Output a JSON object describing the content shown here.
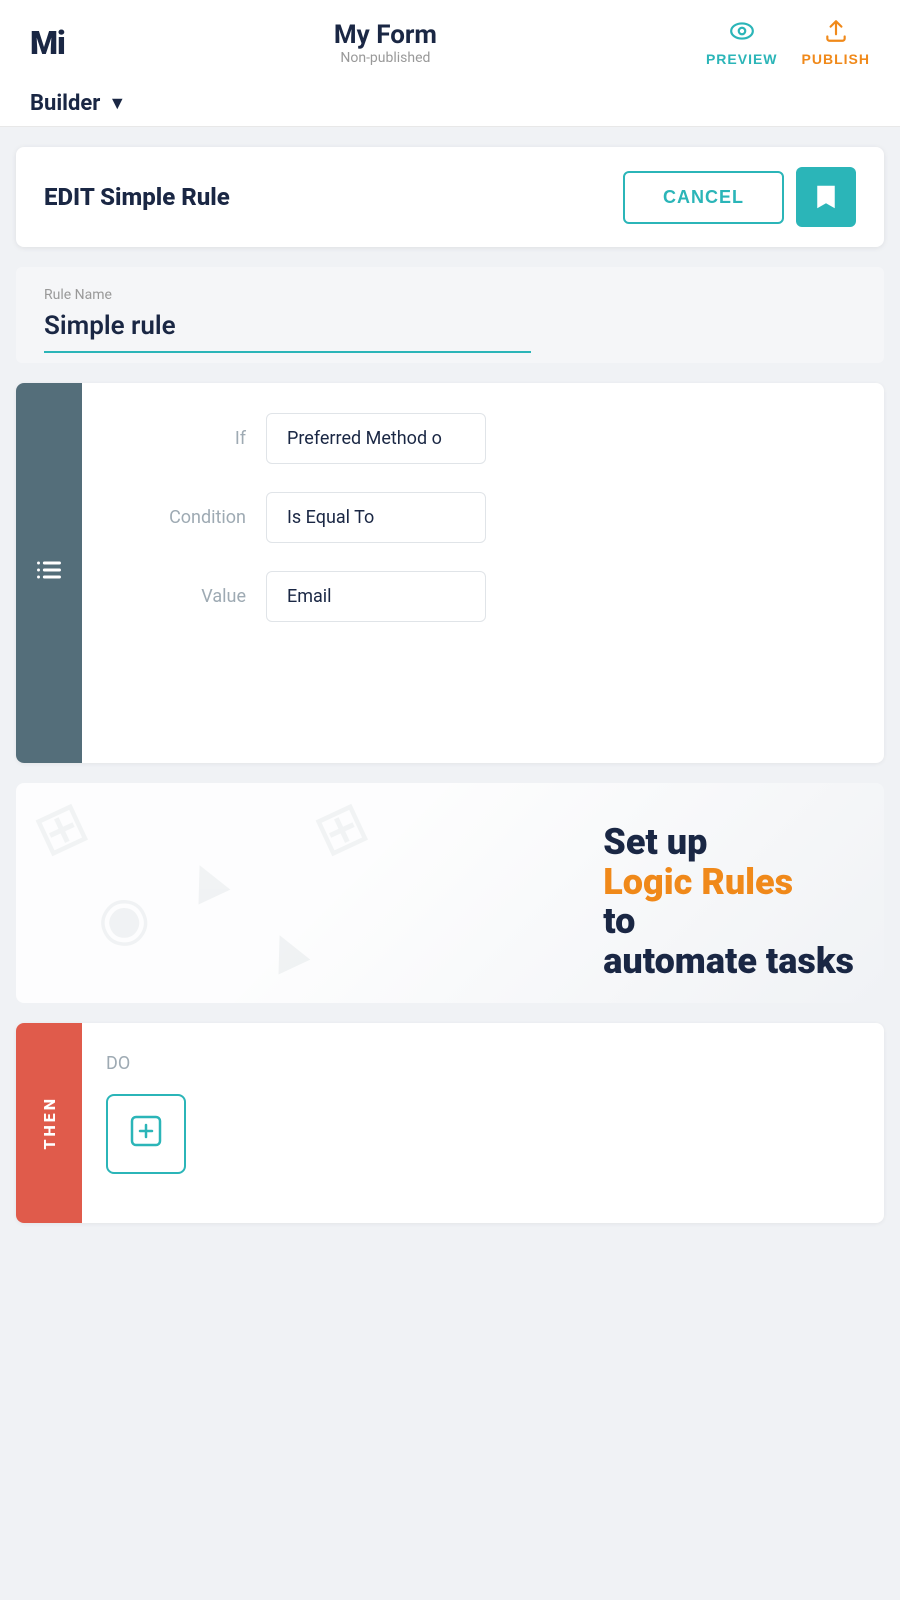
{
  "header": {
    "logo": "Mi",
    "form_title": "My Form",
    "form_status": "Non-published",
    "preview_label": "PREVIEW",
    "publish_label": "PUBLISH"
  },
  "builder": {
    "label": "Builder",
    "chevron": "▼"
  },
  "edit_rule": {
    "title": "EDIT Simple Rule",
    "cancel_label": "CANCEL"
  },
  "rule_name": {
    "label": "Rule Name",
    "value": "Simple rule"
  },
  "condition": {
    "if_label": "If",
    "if_value": "Preferred Method o",
    "condition_label": "Condition",
    "condition_value": "Is Equal To",
    "value_label": "Value",
    "value_value": "Email"
  },
  "promo": {
    "line1": "Set up",
    "line2": "Logic Rules",
    "line3": "to",
    "line4": "automate tasks"
  },
  "then": {
    "sidebar_label": "THEN",
    "do_label": "DO",
    "add_action_label": "+"
  }
}
